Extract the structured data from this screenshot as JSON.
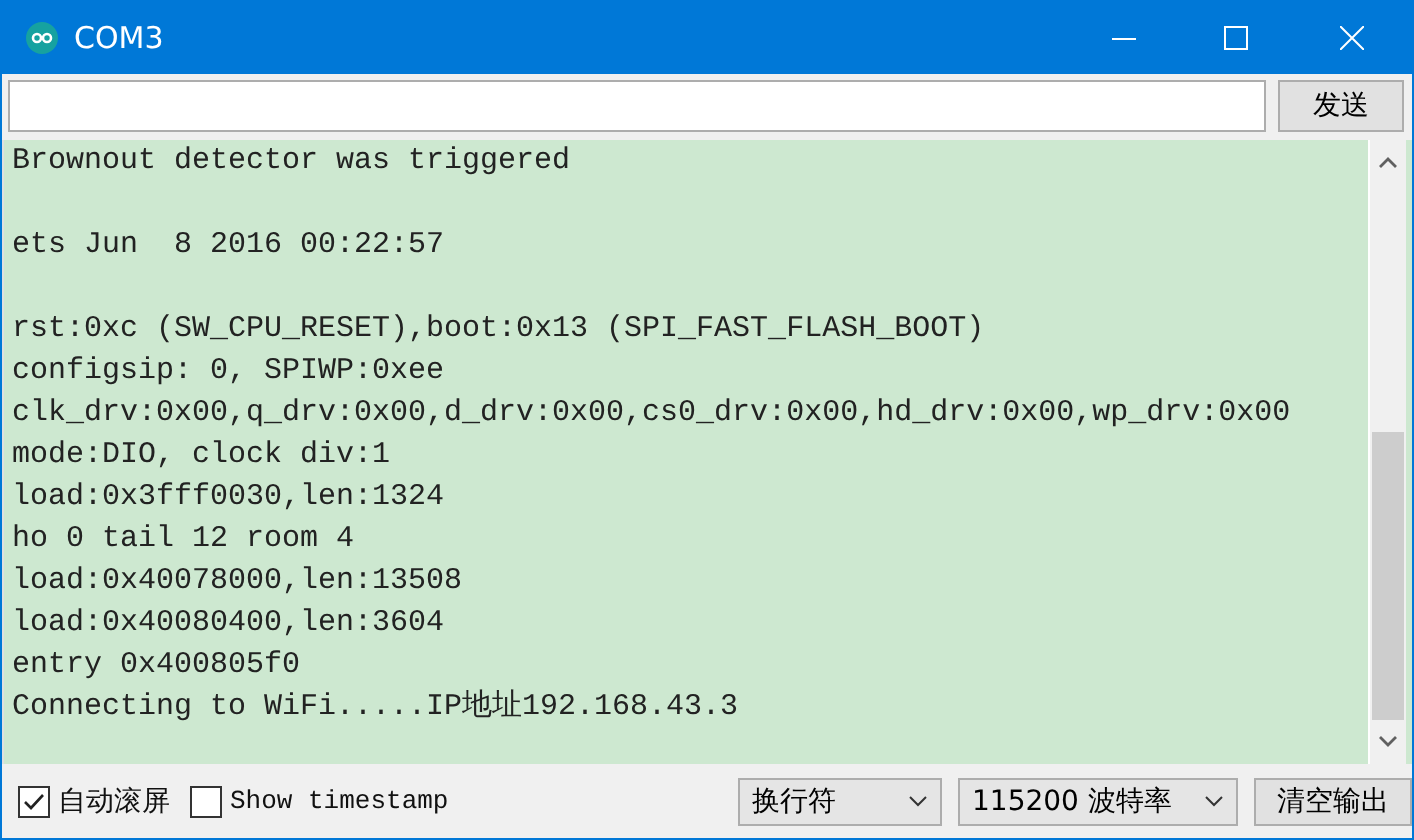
{
  "window": {
    "title": "COM3"
  },
  "send_bar": {
    "send_button": "发送"
  },
  "console": {
    "lines": [
      {
        "text": "Brownout detector was triggered",
        "blank_before": false
      },
      {
        "text": "ets Jun  8 2016 00:22:57",
        "blank_before": true
      },
      {
        "text": "rst:0xc (SW_CPU_RESET),boot:0x13 (SPI_FAST_FLASH_BOOT)",
        "blank_before": true
      },
      {
        "text": "configsip: 0, SPIWP:0xee",
        "blank_before": false
      },
      {
        "text": "clk_drv:0x00,q_drv:0x00,d_drv:0x00,cs0_drv:0x00,hd_drv:0x00,wp_drv:0x00",
        "blank_before": false
      },
      {
        "text": "mode:DIO, clock div:1",
        "blank_before": false
      },
      {
        "text": "load:0x3fff0030,len:1324",
        "blank_before": false
      },
      {
        "text": "ho 0 tail 12 room 4",
        "blank_before": false
      },
      {
        "text": "load:0x40078000,len:13508",
        "blank_before": false
      },
      {
        "text": "load:0x40080400,len:3604",
        "blank_before": false
      },
      {
        "text": "entry 0x400805f0",
        "blank_before": false
      },
      {
        "text": "Connecting to WiFi.....IP地址192.168.43.3",
        "blank_before": false
      }
    ]
  },
  "bottom_bar": {
    "checkboxes": [
      {
        "label": "自动滚屏",
        "checked": true,
        "kind": "sans"
      },
      {
        "label": "Show timestamp",
        "checked": false,
        "kind": "mono"
      }
    ],
    "line_ending": "换行符",
    "baud_rate": "115200 波特率",
    "clear_button": "清空输出"
  }
}
